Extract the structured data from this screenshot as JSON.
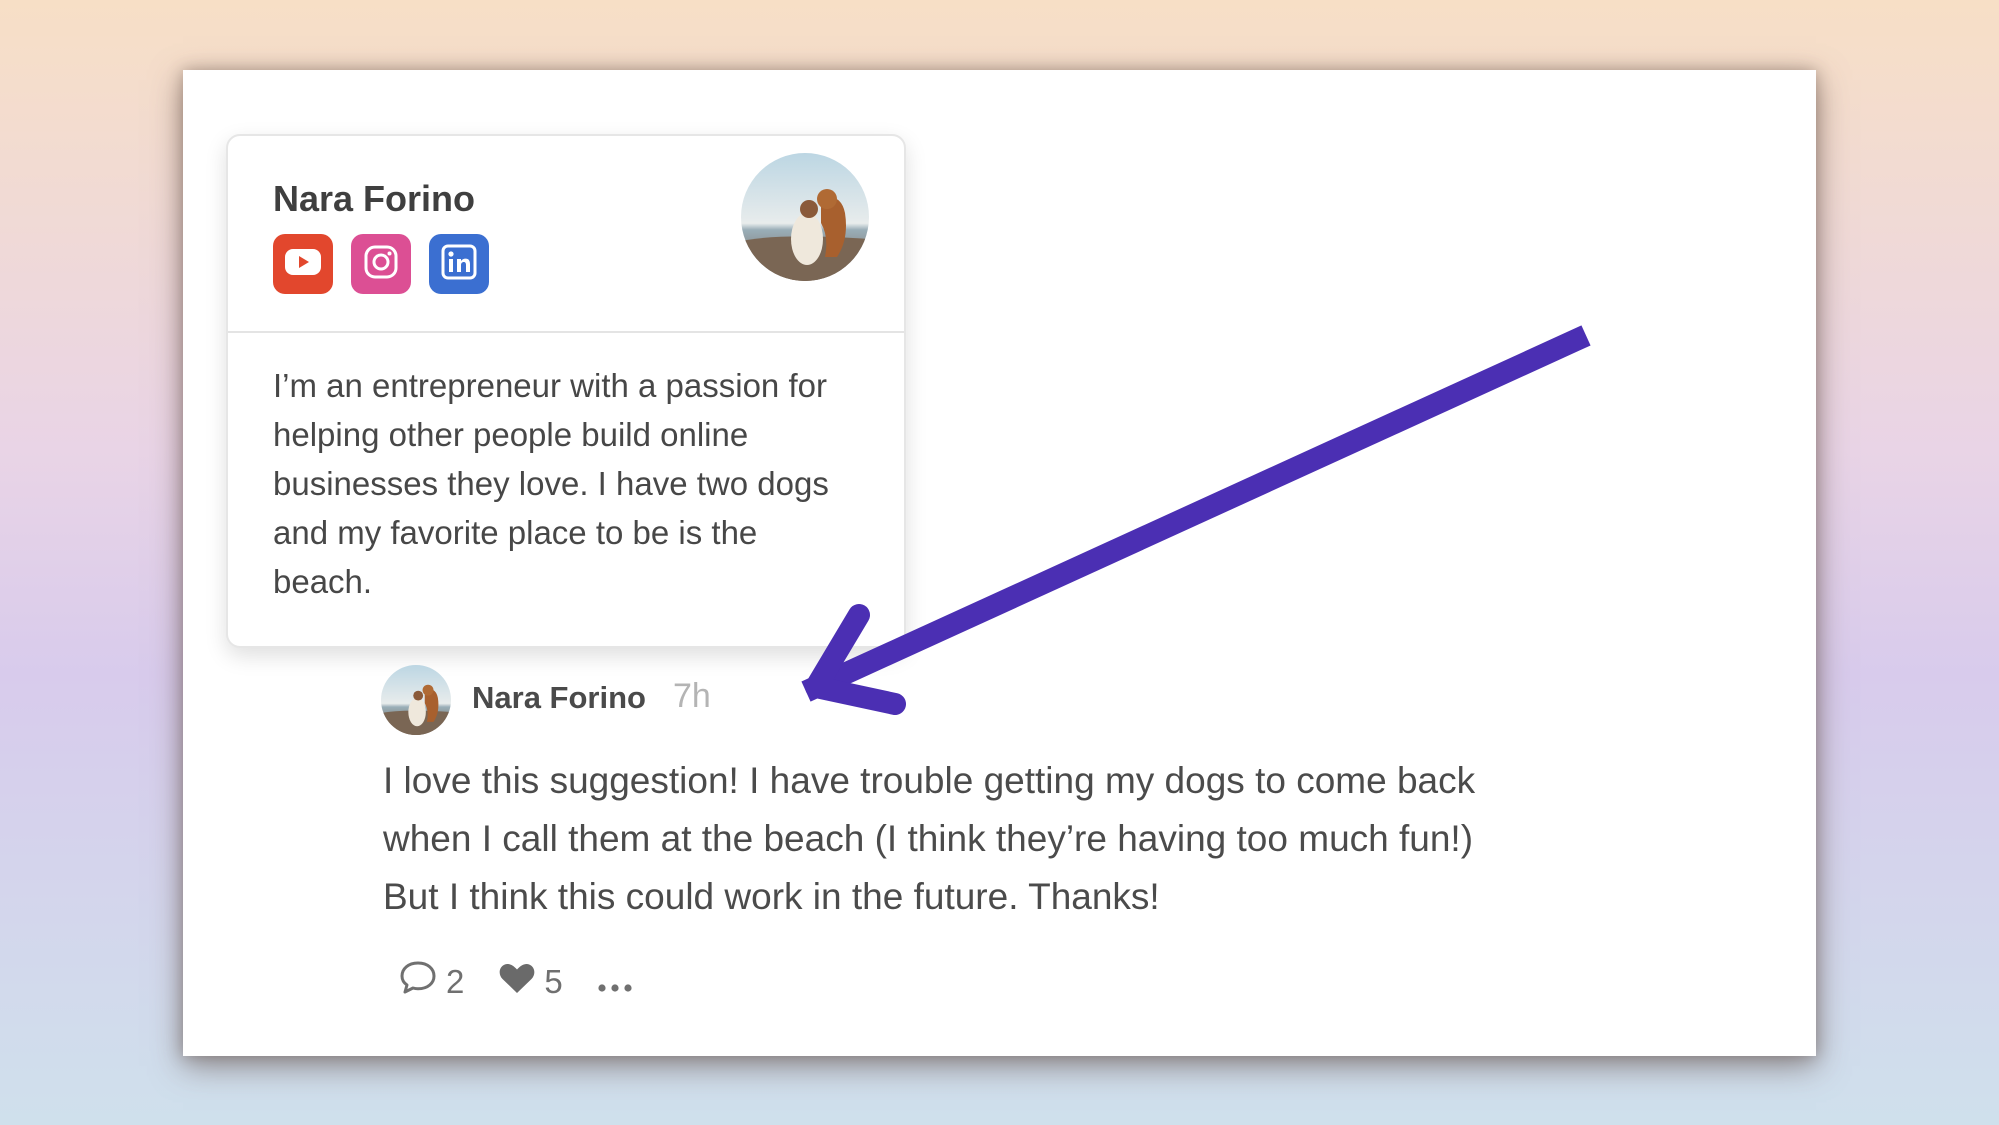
{
  "profile_card": {
    "name": "Nara Forino",
    "social_links": [
      {
        "icon": "youtube-icon",
        "color": "#e2472d"
      },
      {
        "icon": "instagram-icon",
        "color": "#dc4f94"
      },
      {
        "icon": "linkedin-icon",
        "color": "#3b6fd1"
      }
    ],
    "bio": "I’m an entrepreneur with a passion for helping other people build online businesses they love. I have two dogs and my favorite place to be is the beach."
  },
  "comment": {
    "author": "Nara Forino",
    "time": "7h",
    "body_lines": [
      "I love this suggestion! I have trouble getting my dogs to come back",
      "when I call them at the beach (I think they’re having too much fun!)",
      "But I think this could work in the future. Thanks!"
    ],
    "replies_count": "2",
    "likes_count": "5"
  },
  "colors": {
    "arrow": "#4b2fb3"
  }
}
